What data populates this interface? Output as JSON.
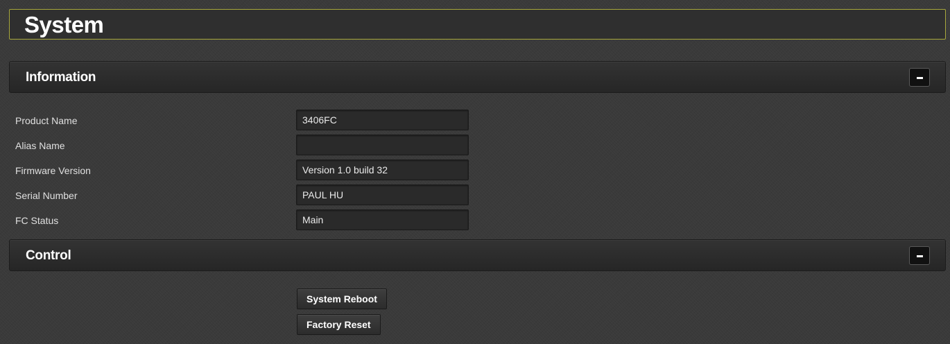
{
  "page": {
    "title": "System"
  },
  "information": {
    "title": "Information",
    "collapse_label": "−",
    "rows": [
      {
        "label": "Product Name",
        "value": "3406FC"
      },
      {
        "label": "Alias Name",
        "value": ""
      },
      {
        "label": "Firmware Version",
        "value": "Version 1.0 build 32"
      },
      {
        "label": "Serial Number",
        "value": "PAUL HU"
      },
      {
        "label": "FC Status",
        "value": "Main"
      }
    ]
  },
  "control": {
    "title": "Control",
    "collapse_label": "−",
    "reboot_label": "System Reboot",
    "reset_label": "Factory Reset"
  },
  "colors": {
    "background": "#3a3a3a",
    "title_border": "#a8a83c",
    "text": "#e6e6e6"
  },
  "icons": {
    "collapse": "minus-icon"
  }
}
